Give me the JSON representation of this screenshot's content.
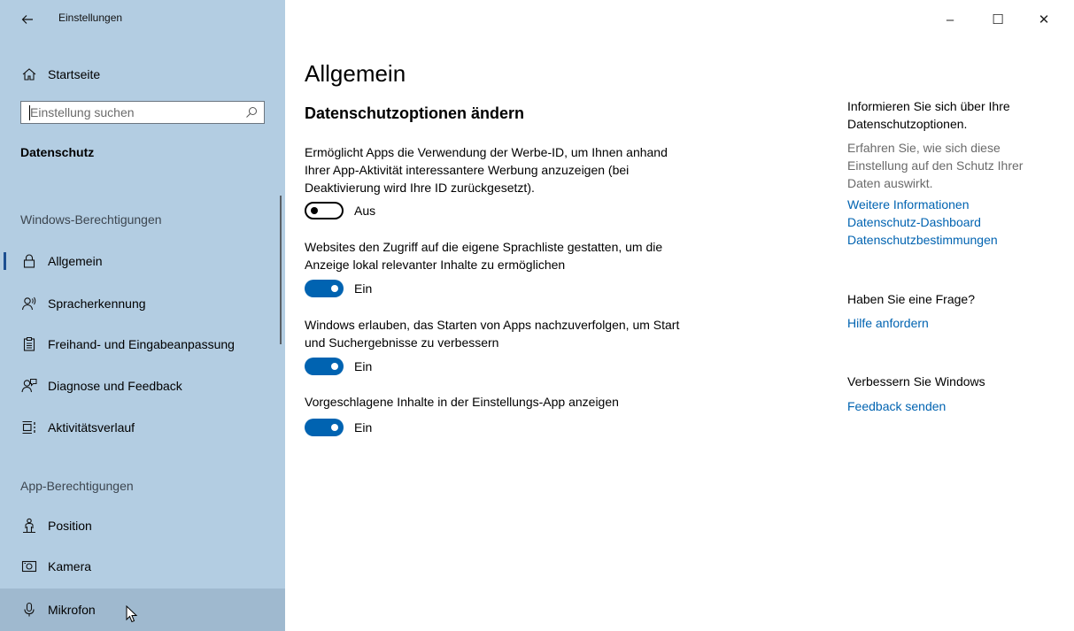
{
  "window": {
    "title": "Einstellungen",
    "back_icon": "arrow-left-icon",
    "controls": {
      "minimize": "–",
      "maximize": "☐",
      "close": "✕"
    }
  },
  "sidebar": {
    "home_label": "Startseite",
    "search_placeholder": "Einstellung suchen",
    "category_title": "Datenschutz",
    "group_windows": "Windows-Berechtigungen",
    "group_apps": "App-Berechtigungen",
    "windows_items": [
      {
        "label": "Allgemein",
        "icon": "lock-icon",
        "active": true
      },
      {
        "label": "Spracherkennung",
        "icon": "speech-icon"
      },
      {
        "label": "Freihand- und Eingabeanpassung",
        "icon": "clipboard-icon"
      },
      {
        "label": "Diagnose und Feedback",
        "icon": "feedback-icon"
      },
      {
        "label": "Aktivitätsverlauf",
        "icon": "timeline-icon"
      }
    ],
    "app_items": [
      {
        "label": "Position",
        "icon": "location-person-icon"
      },
      {
        "label": "Kamera",
        "icon": "camera-icon"
      },
      {
        "label": "Mikrofon",
        "icon": "microphone-icon",
        "hovered": true
      }
    ]
  },
  "main": {
    "title": "Allgemein",
    "section_title": "Datenschutzoptionen ändern",
    "options": [
      {
        "description": "Ermöglicht Apps die Verwendung der Werbe-ID, um Ihnen anhand Ihrer App-Aktivität interessantere Werbung anzuzeigen (bei Deaktivierung wird Ihre ID zurückgesetzt).",
        "state_label": "Aus",
        "on": false
      },
      {
        "description": "Websites den Zugriff auf die eigene Sprachliste gestatten, um die Anzeige lokal relevanter Inhalte zu ermöglichen",
        "state_label": "Ein",
        "on": true
      },
      {
        "description": "Windows erlauben, das Starten von Apps nachzuverfolgen, um Start und Suchergebnisse zu verbessern",
        "state_label": "Ein",
        "on": true
      },
      {
        "description": "Vorgeschlagene Inhalte in der Einstellungs-App anzeigen",
        "state_label": "Ein",
        "on": true
      }
    ]
  },
  "aside": {
    "info_heading": "Informieren Sie sich über Ihre Datenschutzoptionen.",
    "info_text": "Erfahren Sie, wie sich diese Einstellung auf den Schutz Ihrer Daten auswirkt.",
    "links": [
      "Weitere Informationen",
      "Datenschutz-Dashboard",
      "Datenschutzbestimmungen"
    ],
    "question_heading": "Haben Sie eine Frage?",
    "help_link": "Hilfe anfordern",
    "improve_heading": "Verbessern Sie Windows",
    "feedback_link": "Feedback senden"
  },
  "colors": {
    "sidebar_bg": "#b3cde2",
    "accent": "#0063b1",
    "active_indicator": "#1d4f91",
    "hover_bg": "#9fb9cf"
  }
}
